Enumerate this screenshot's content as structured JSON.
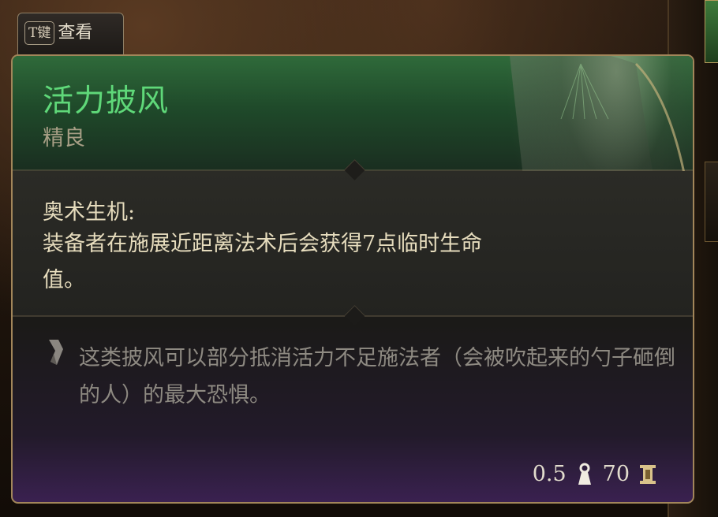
{
  "hotkey": {
    "key": "T键",
    "label": "查看"
  },
  "item": {
    "name": "活力披风",
    "rarity": "精良",
    "name_color": "#5fd879",
    "effect_title": "奥术生机:",
    "effect_description": "装备者在施展近距离法术后会获得7点临时生命值。",
    "flavor_text": "这类披风可以部分抵消活力不足施法者（会被吹起来的勺子砸倒的人）的最大恐惧。",
    "weight": "0.5",
    "weight_icon": "weight-icon",
    "value": "70",
    "value_icon": "gold-coin-icon"
  }
}
